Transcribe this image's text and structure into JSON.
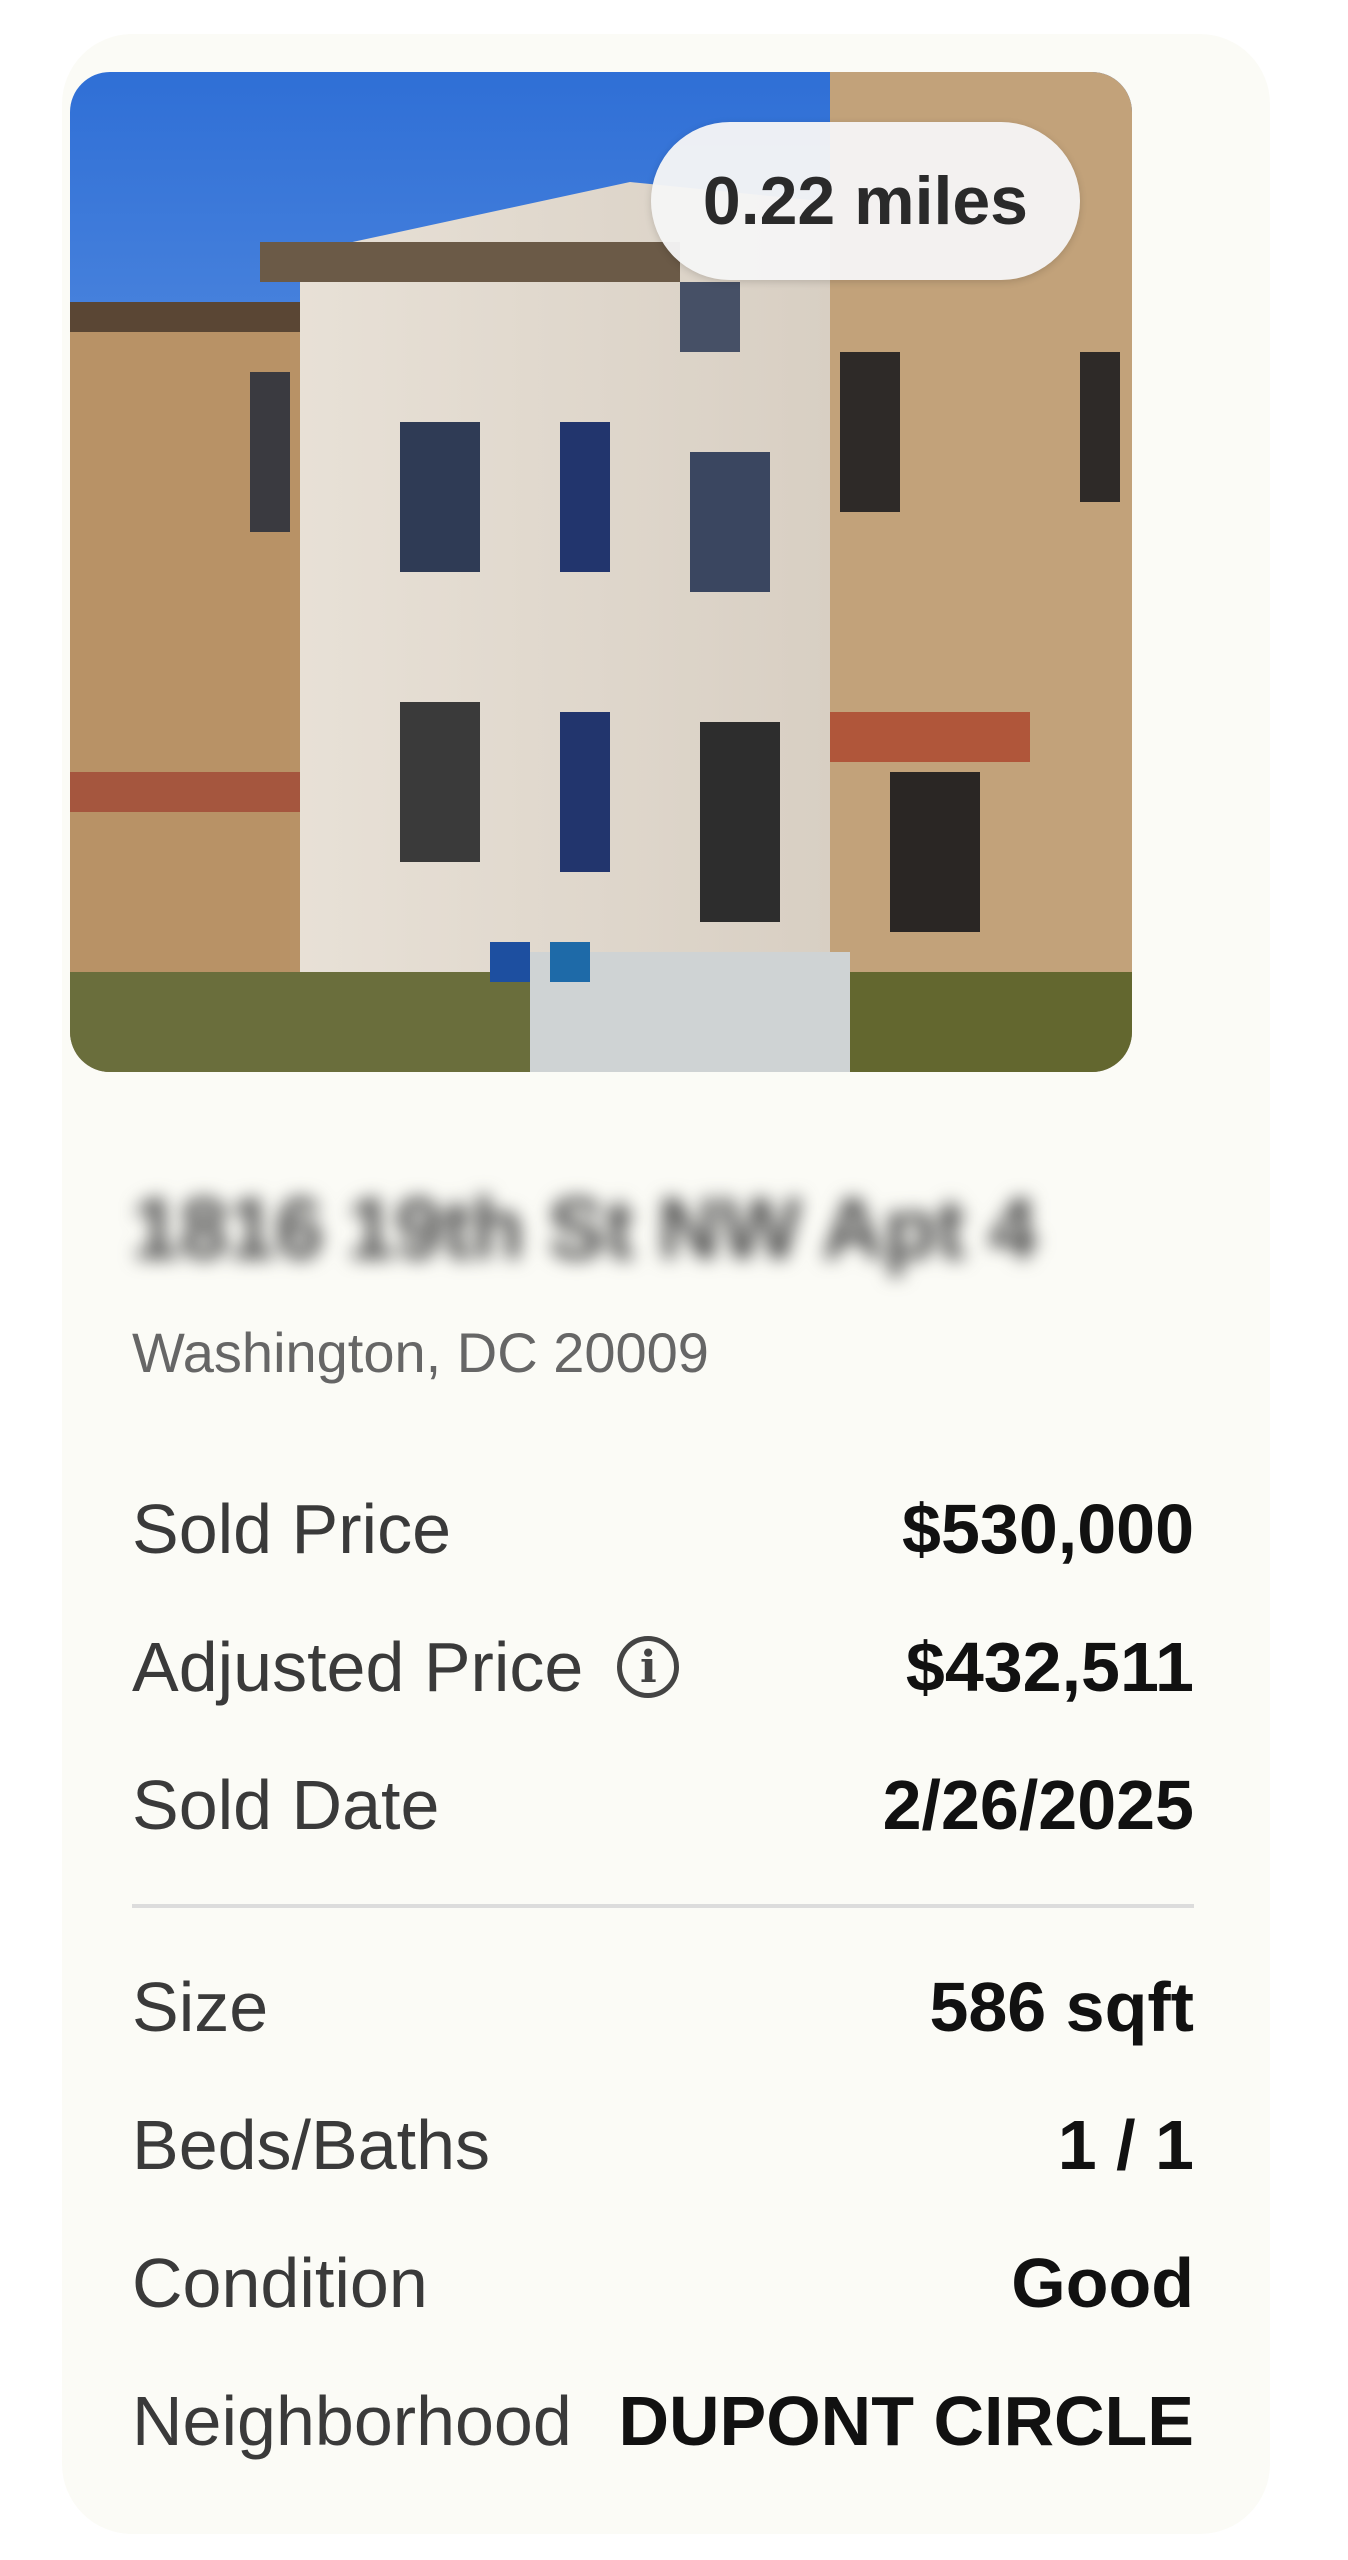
{
  "listing": {
    "distance": "0.22 miles",
    "address_blurred": "1816 19th St NW Apt 4",
    "city_line": "Washington, DC 20009",
    "photo_icon": "house-photo"
  },
  "price_details": [
    {
      "label": "Sold Price",
      "value": "$530,000"
    },
    {
      "label": "Adjusted Price",
      "value": "$432,511",
      "icon": "info-icon"
    },
    {
      "label": "Sold Date",
      "value": "2/26/2025"
    }
  ],
  "property_details": [
    {
      "label": "Size",
      "value": "586 sqft"
    },
    {
      "label": "Beds/Baths",
      "value": "1 / 1"
    },
    {
      "label": "Condition",
      "value": "Good"
    },
    {
      "label": "Neighborhood",
      "value": "DUPONT CIRCLE"
    }
  ],
  "colors": {
    "card_bg": "#fbfbf6",
    "text_primary": "#111111",
    "text_secondary": "#3a3a3a"
  }
}
